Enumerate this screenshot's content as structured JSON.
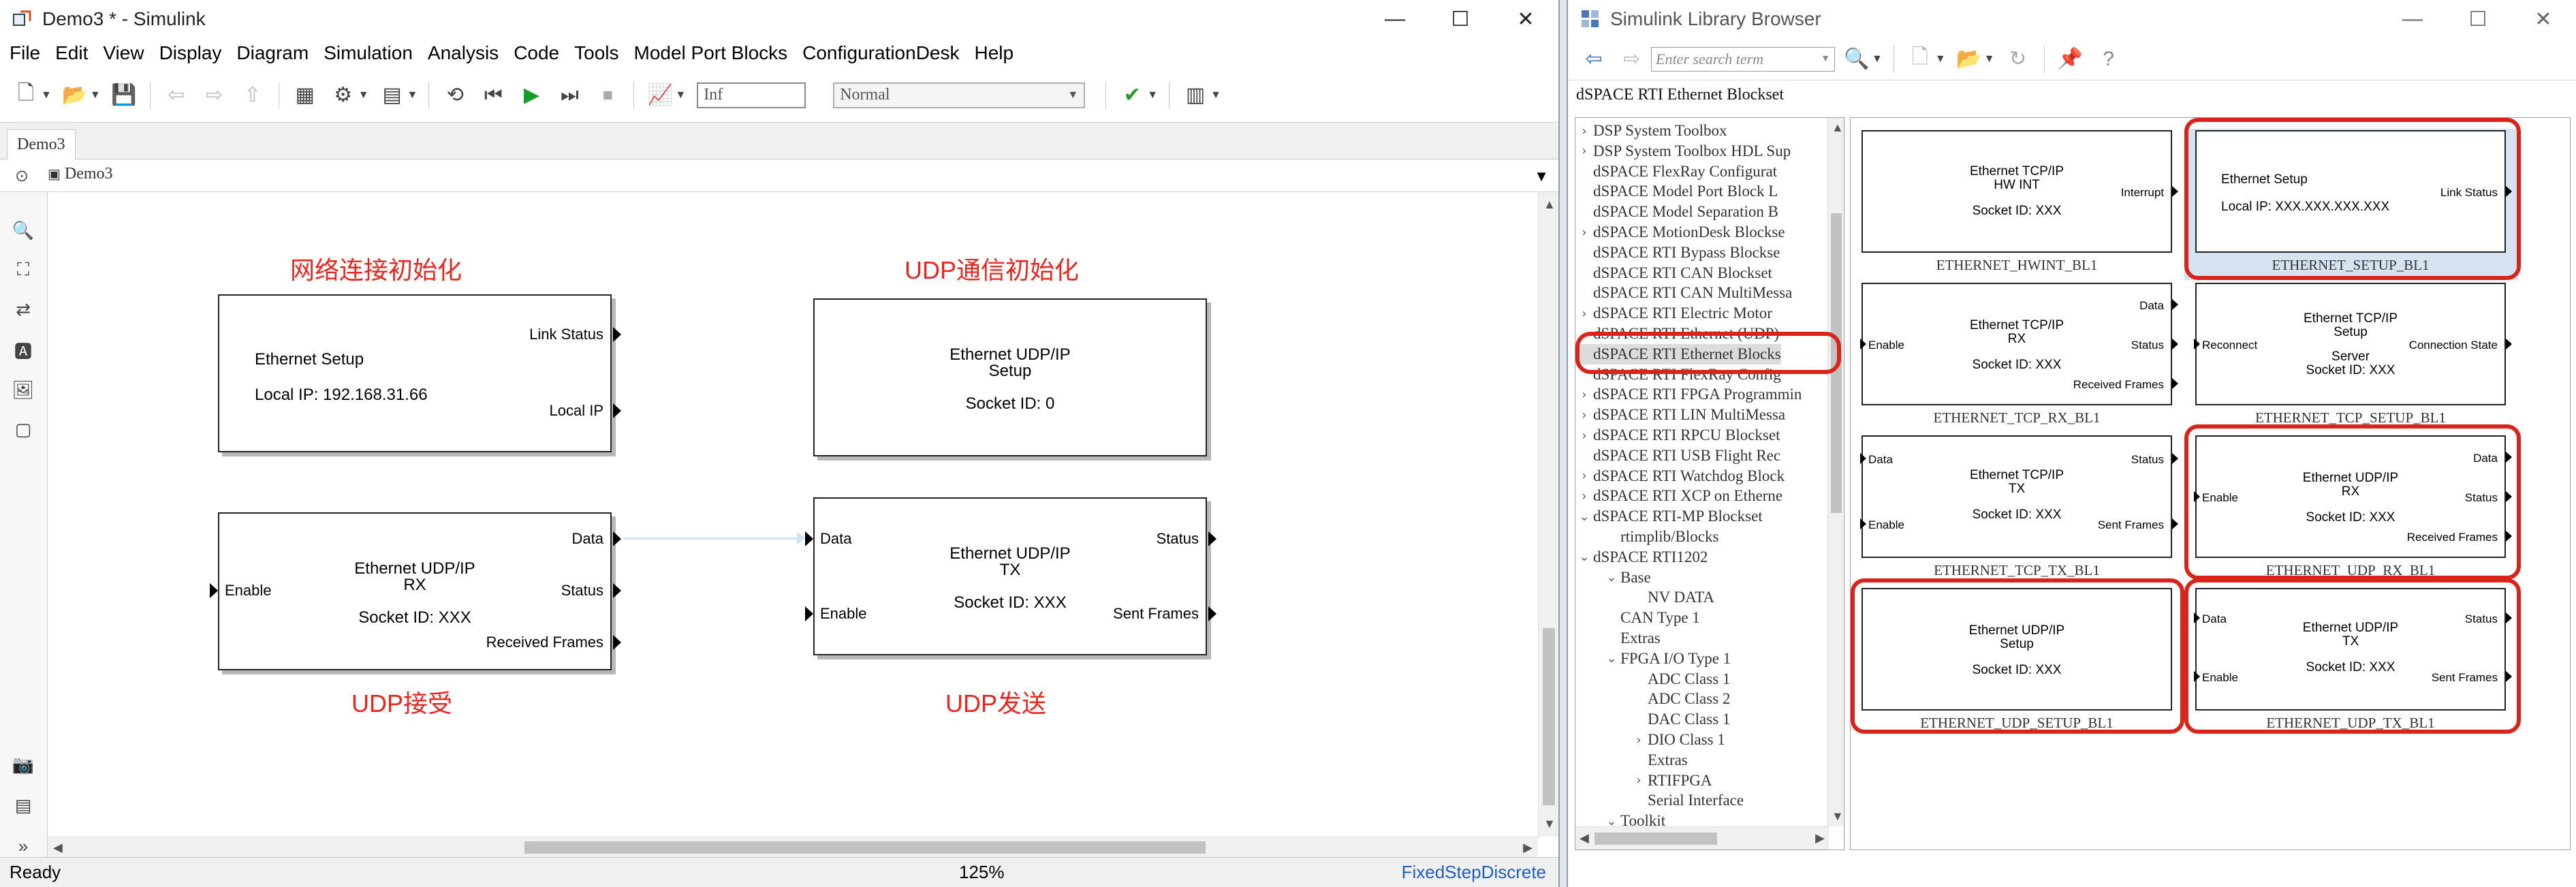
{
  "simulink": {
    "title": "Demo3 * - Simulink",
    "menus": [
      "File",
      "Edit",
      "View",
      "Display",
      "Diagram",
      "Simulation",
      "Analysis",
      "Code",
      "Tools",
      "Model Port Blocks",
      "ConfigurationDesk",
      "Help"
    ],
    "stop_time": "Inf",
    "sim_mode": "Normal",
    "tab": "Demo3",
    "breadcrumb": "Demo3",
    "status": {
      "left": "Ready",
      "zoom": "125%",
      "solver": "FixedStepDiscrete"
    },
    "annotations": {
      "net_init": "网络连接初始化",
      "udp_init": "UDP通信初始化",
      "udp_rx": "UDP接受",
      "udp_tx": "UDP发送"
    },
    "blocks": {
      "setup": {
        "line1": "Ethernet Setup",
        "line2": "Local IP: 192.168.31.66",
        "out1": "Link Status",
        "out2": "Local IP"
      },
      "udp_setup": {
        "line1": "Ethernet UDP/IP",
        "line2": "Setup",
        "line3": "Socket ID: 0"
      },
      "udp_rx": {
        "line1": "Ethernet UDP/IP",
        "line2": "RX",
        "line3": "Socket ID: XXX",
        "in1": "Enable",
        "out1": "Data",
        "out2": "Status",
        "out3": "Received Frames"
      },
      "udp_tx": {
        "line1": "Ethernet UDP/IP",
        "line2": "TX",
        "line3": "Socket ID: XXX",
        "in1": "Data",
        "in2": "Enable",
        "out1": "Status",
        "out2": "Sent Frames"
      }
    },
    "colors": {
      "annotation": "#e8261f",
      "signal_line": "#cfe3f5"
    }
  },
  "library": {
    "title": "Simulink Library Browser",
    "search_placeholder": "Enter search term",
    "path": "dSPACE RTI Ethernet Blockset",
    "tree": [
      {
        "label": "DSP System Toolbox",
        "chev": ">"
      },
      {
        "label": "DSP System Toolbox HDL Sup",
        "chev": ">"
      },
      {
        "label": "dSPACE FlexRay Configurat",
        "chev": ""
      },
      {
        "label": "dSPACE Model Port Block L",
        "chev": ""
      },
      {
        "label": "dSPACE Model Separation B",
        "chev": ""
      },
      {
        "label": "dSPACE MotionDesk Blockse",
        "chev": ">"
      },
      {
        "label": "dSPACE RTI Bypass Blockse",
        "chev": ""
      },
      {
        "label": "dSPACE RTI CAN Blockset",
        "chev": ""
      },
      {
        "label": "dSPACE RTI CAN MultiMessa",
        "chev": ""
      },
      {
        "label": "dSPACE RTI Electric Motor",
        "chev": ">"
      },
      {
        "label": "dSPACE RTI Ethernet (UDP)",
        "chev": ""
      },
      {
        "label": "dSPACE RTI Ethernet Blocks",
        "chev": "",
        "selected": true
      },
      {
        "label": "dSPACE RTI FlexRay Config",
        "chev": ""
      },
      {
        "label": "dSPACE RTI FPGA Programmin",
        "chev": ">"
      },
      {
        "label": "dSPACE RTI LIN MultiMessa",
        "chev": ">"
      },
      {
        "label": "dSPACE RTI RPCU Blockset",
        "chev": ">"
      },
      {
        "label": "dSPACE RTI USB Flight Rec",
        "chev": ""
      },
      {
        "label": "dSPACE RTI Watchdog Block",
        "chev": ">"
      },
      {
        "label": "dSPACE RTI XCP on Etherne",
        "chev": ">"
      },
      {
        "label": "dSPACE RTI-MP Blockset",
        "chev": "v"
      },
      {
        "label": "rtimplib/Blocks",
        "chev": "",
        "indent": 1
      },
      {
        "label": "dSPACE RTI1202",
        "chev": "v"
      },
      {
        "label": "Base",
        "chev": "v",
        "indent": 1
      },
      {
        "label": "NV DATA",
        "chev": "",
        "indent": 2
      },
      {
        "label": "CAN Type 1",
        "chev": "",
        "indent": 1
      },
      {
        "label": "Extras",
        "chev": "",
        "indent": 1
      },
      {
        "label": "FPGA I/O Type 1",
        "chev": "v",
        "indent": 1
      },
      {
        "label": "ADC Class 1",
        "chev": "",
        "indent": 2
      },
      {
        "label": "ADC Class 2",
        "chev": "",
        "indent": 2
      },
      {
        "label": "DAC Class 1",
        "chev": "",
        "indent": 2
      },
      {
        "label": "DIO Class 1",
        "chev": ">",
        "indent": 2
      },
      {
        "label": "Extras",
        "chev": "",
        "indent": 2
      },
      {
        "label": "RTIFPGA",
        "chev": ">",
        "indent": 2
      },
      {
        "label": "Serial Interface",
        "chev": "",
        "indent": 2
      },
      {
        "label": "Toolkit",
        "chev": "v",
        "indent": 1
      }
    ],
    "blocks": {
      "hwint": {
        "l1": "Ethernet TCP/IP",
        "l2": "HW INT",
        "l3": "Socket ID: XXX",
        "o1": "Interrupt",
        "name": "ETHERNET_HWINT_BL1"
      },
      "setup": {
        "l1": "Ethernet Setup",
        "l2": "Local IP: XXX.XXX.XXX.XXX",
        "o1": "Link Status",
        "name": "ETHERNET_SETUP_BL1"
      },
      "tcp_rx": {
        "l1": "Ethernet TCP/IP",
        "l2": "RX",
        "l3": "Socket ID: XXX",
        "i1": "Enable",
        "o1": "Data",
        "o2": "Status",
        "o3": "Received Frames",
        "name": "ETHERNET_TCP_RX_BL1"
      },
      "tcp_setup": {
        "l1": "Ethernet TCP/IP",
        "l2": "Setup",
        "l3": "Server",
        "l4": "Socket ID: XXX",
        "i1": "Reconnect",
        "o1": "Connection State",
        "name": "ETHERNET_TCP_SETUP_BL1"
      },
      "tcp_tx": {
        "l1": "Ethernet TCP/IP",
        "l2": "TX",
        "l3": "Socket ID: XXX",
        "i1": "Data",
        "i2": "Enable",
        "o1": "Status",
        "o2": "Sent Frames",
        "name": "ETHERNET_TCP_TX_BL1"
      },
      "udp_rx": {
        "l1": "Ethernet UDP/IP",
        "l2": "RX",
        "l3": "Socket ID: XXX",
        "i1": "Enable",
        "o1": "Data",
        "o2": "Status",
        "o3": "Received Frames",
        "name": "ETHERNET_UDP_RX_BL1"
      },
      "udp_setup": {
        "l1": "Ethernet UDP/IP",
        "l2": "Setup",
        "l3": "Socket ID: XXX",
        "name": "ETHERNET_UDP_SETUP_BL1"
      },
      "udp_tx": {
        "l1": "Ethernet UDP/IP",
        "l2": "TX",
        "l3": "Socket ID: XXX",
        "i1": "Data",
        "i2": "Enable",
        "o1": "Status",
        "o2": "Sent Frames",
        "name": "ETHERNET_UDP_TX_BL1"
      }
    },
    "colors": {
      "highlight": "#d9241c"
    }
  }
}
